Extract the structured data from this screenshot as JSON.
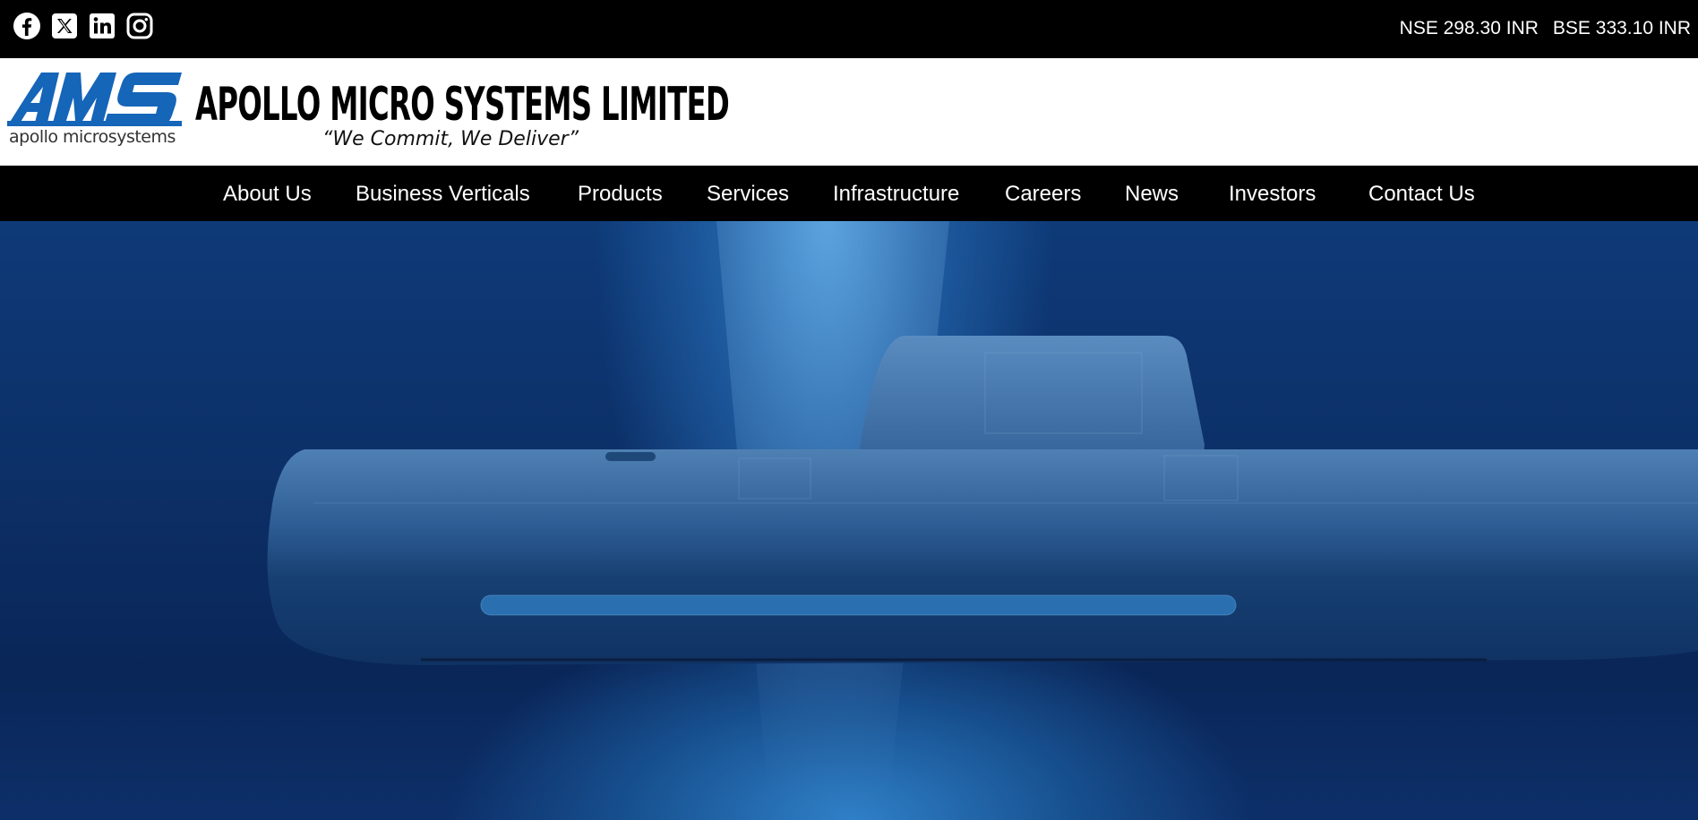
{
  "topbar": {
    "social": [
      {
        "name": "facebook-icon"
      },
      {
        "name": "x-twitter-icon"
      },
      {
        "name": "linkedin-icon"
      },
      {
        "name": "instagram-icon"
      }
    ],
    "nse": "NSE 298.30 INR",
    "bse": "BSE 333.10 INR"
  },
  "header": {
    "logo_text": "AMS",
    "logo_subtext": "apollo microsystems",
    "company_name": "APOLLO MICRO SYSTEMS LIMITED",
    "tagline": "“We Commit, We Deliver”",
    "brand_color": "#1565b8"
  },
  "nav": {
    "items": [
      {
        "label": "About Us"
      },
      {
        "label": "Business Verticals"
      },
      {
        "label": "Products"
      },
      {
        "label": "Services"
      },
      {
        "label": "Infrastructure"
      },
      {
        "label": "Careers"
      },
      {
        "label": "News"
      },
      {
        "label": "Investors"
      },
      {
        "label": "Contact Us"
      }
    ]
  },
  "hero": {
    "image": "submarine-underwater-banner"
  }
}
